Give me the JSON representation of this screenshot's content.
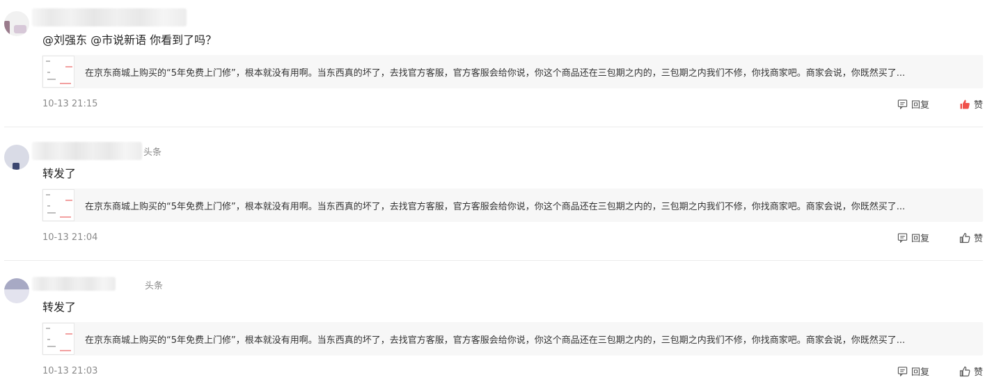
{
  "comments": [
    {
      "text": "@刘强东 @市说新语 你看到了吗？",
      "source": "",
      "quote": "在京东商城上购买的“5年免费上门修”，根本就没有用啊。当东西真的坏了，去找官方客服，官方客服会给你说，你这个商品还在三包期之内的，三包期之内我们不修，你找商家吧。商家会说，你既然买了...",
      "time": "10-13 21:15",
      "reply_label": "回复",
      "like_label": "赞",
      "liked": true
    },
    {
      "text": "转发了",
      "source": "头条",
      "quote": "在京东商城上购买的“5年免费上门修”，根本就没有用啊。当东西真的坏了，去找官方客服，官方客服会给你说，你这个商品还在三包期之内的，三包期之内我们不修，你找商家吧。商家会说，你既然买了...",
      "time": "10-13 21:04",
      "reply_label": "回复",
      "like_label": "赞",
      "liked": false
    },
    {
      "text": "转发了",
      "source": "头条",
      "quote": "在京东商城上购买的“5年免费上门修”，根本就没有用啊。当东西真的坏了，去找官方客服，官方客服会给你说，你这个商品还在三包期之内的，三包期之内我们不修，你找商家吧。商家会说，你既然买了...",
      "time": "10-13 21:03",
      "reply_label": "回复",
      "like_label": "赞",
      "liked": false
    }
  ],
  "colors": {
    "liked_icon": "#f0504a",
    "icon": "#555555"
  },
  "icons": {
    "reply": "comment-icon",
    "like": "thumbs-up-icon"
  }
}
